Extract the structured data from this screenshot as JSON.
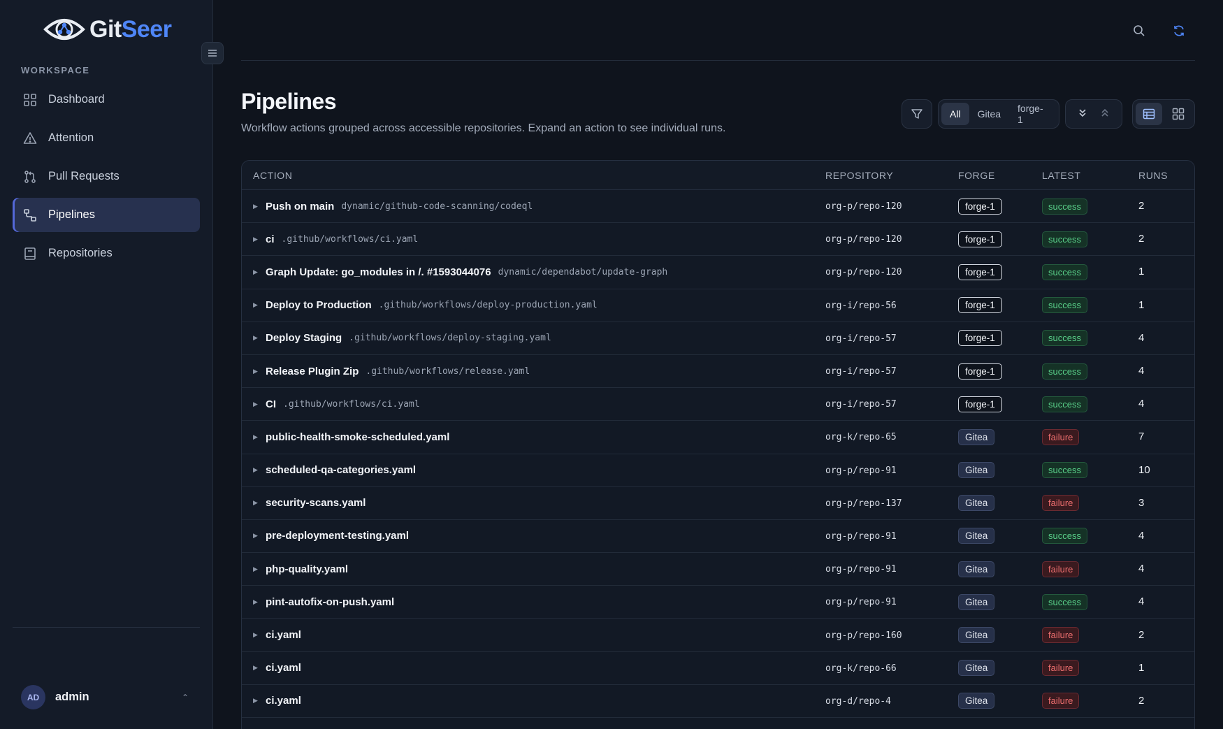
{
  "app": {
    "name_part1": "Git",
    "name_part2": "Seer",
    "accent": "#4f86f7"
  },
  "sidebar": {
    "section_label": "WORKSPACE",
    "items": [
      {
        "label": "Dashboard",
        "icon": "grid-icon"
      },
      {
        "label": "Attention",
        "icon": "warning-icon"
      },
      {
        "label": "Pull Requests",
        "icon": "pull-request-icon"
      },
      {
        "label": "Pipelines",
        "icon": "pipeline-icon",
        "active": true
      },
      {
        "label": "Repositories",
        "icon": "repository-icon"
      }
    ],
    "user": {
      "initials": "AD",
      "name": "admin"
    }
  },
  "header": {
    "title": "Pipelines",
    "subtitle": "Workflow actions grouped across accessible repositories. Expand an action to see individual runs.",
    "filters": [
      "All",
      "Gitea",
      "forge-1"
    ],
    "active_filter": "All"
  },
  "table": {
    "columns": [
      "ACTION",
      "REPOSITORY",
      "FORGE",
      "LATEST",
      "RUNS"
    ],
    "rows": [
      {
        "name": "Push on main",
        "path": "dynamic/github-code-scanning/codeql",
        "repo": "org-p/repo-120",
        "forge": "forge-1",
        "status": "success",
        "runs": "2"
      },
      {
        "name": "ci",
        "path": ".github/workflows/ci.yaml",
        "repo": "org-p/repo-120",
        "forge": "forge-1",
        "status": "success",
        "runs": "2"
      },
      {
        "name": "Graph Update: go_modules in /. #1593044076",
        "path": "dynamic/dependabot/update-graph",
        "repo": "org-p/repo-120",
        "forge": "forge-1",
        "status": "success",
        "runs": "1"
      },
      {
        "name": "Deploy to Production",
        "path": ".github/workflows/deploy-production.yaml",
        "repo": "org-i/repo-56",
        "forge": "forge-1",
        "status": "success",
        "runs": "1"
      },
      {
        "name": "Deploy Staging",
        "path": ".github/workflows/deploy-staging.yaml",
        "repo": "org-i/repo-57",
        "forge": "forge-1",
        "status": "success",
        "runs": "4"
      },
      {
        "name": "Release Plugin Zip",
        "path": ".github/workflows/release.yaml",
        "repo": "org-i/repo-57",
        "forge": "forge-1",
        "status": "success",
        "runs": "4"
      },
      {
        "name": "CI",
        "path": ".github/workflows/ci.yaml",
        "repo": "org-i/repo-57",
        "forge": "forge-1",
        "status": "success",
        "runs": "4"
      },
      {
        "name": "public-health-smoke-scheduled.yaml",
        "path": "",
        "repo": "org-k/repo-65",
        "forge": "Gitea",
        "status": "failure",
        "runs": "7"
      },
      {
        "name": "scheduled-qa-categories.yaml",
        "path": "",
        "repo": "org-p/repo-91",
        "forge": "Gitea",
        "status": "success",
        "runs": "10"
      },
      {
        "name": "security-scans.yaml",
        "path": "",
        "repo": "org-p/repo-137",
        "forge": "Gitea",
        "status": "failure",
        "runs": "3"
      },
      {
        "name": "pre-deployment-testing.yaml",
        "path": "",
        "repo": "org-p/repo-91",
        "forge": "Gitea",
        "status": "success",
        "runs": "4"
      },
      {
        "name": "php-quality.yaml",
        "path": "",
        "repo": "org-p/repo-91",
        "forge": "Gitea",
        "status": "failure",
        "runs": "4"
      },
      {
        "name": "pint-autofix-on-push.yaml",
        "path": "",
        "repo": "org-p/repo-91",
        "forge": "Gitea",
        "status": "success",
        "runs": "4"
      },
      {
        "name": "ci.yaml",
        "path": "",
        "repo": "org-p/repo-160",
        "forge": "Gitea",
        "status": "failure",
        "runs": "2"
      },
      {
        "name": "ci.yaml",
        "path": "",
        "repo": "org-k/repo-66",
        "forge": "Gitea",
        "status": "failure",
        "runs": "1"
      },
      {
        "name": "ci.yaml",
        "path": "",
        "repo": "org-d/repo-4",
        "forge": "Gitea",
        "status": "failure",
        "runs": "2"
      }
    ]
  }
}
